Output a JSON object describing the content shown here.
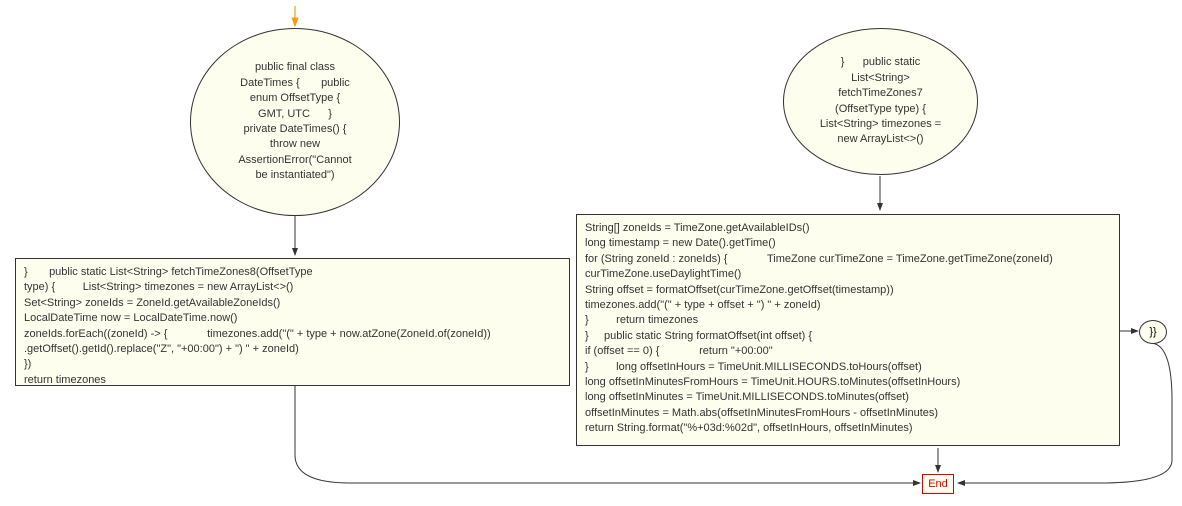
{
  "nodes": {
    "ellipse1": "public final class\nDateTimes {       public\nenum OffsetType {\nGMT, UTC      }\nprivate DateTimes() {\nthrow new\nAssertionError(\"Cannot\nbe instantiated\")",
    "rect1": "}       public static List<String> fetchTimeZones8(OffsetType\ntype) {         List<String> timezones = new ArrayList<>()\nSet<String> zoneIds = ZoneId.getAvailableZoneIds()\nLocalDateTime now = LocalDateTime.now()\nzoneIds.forEach((zoneId) -> {             timezones.add(\"(\" + type + now.atZone(ZoneId.of(zoneId))\n.getOffset().getId().replace(\"Z\", \"+00:00\") + \") \" + zoneId)\n})\nreturn timezones",
    "ellipse2": "}      public static\nList<String>\nfetchTimeZones7\n(OffsetType type) {\nList<String> timezones =\nnew ArrayList<>()",
    "rect2": "String[] zoneIds = TimeZone.getAvailableIDs()\nlong timestamp = new Date().getTime()\nfor (String zoneId : zoneIds) {             TimeZone curTimeZone = TimeZone.getTimeZone(zoneId)\ncurTimeZone.useDaylightTime()\nString offset = formatOffset(curTimeZone.getOffset(timestamp))\ntimezones.add(\"(\" + type + offset + \") \" + zoneId)\n}         return timezones\n}     public static String formatOffset(int offset) {\nif (offset == 0) {             return \"+00:00\"\n}         long offsetInHours = TimeUnit.MILLISECONDS.toHours(offset)\nlong offsetInMinutesFromHours = TimeUnit.HOURS.toMinutes(offsetInHours)\nlong offsetInMinutes = TimeUnit.MILLISECONDS.toMinutes(offset)\noffsetInMinutes = Math.abs(offsetInMinutesFromHours - offsetInMinutes)\nreturn String.format(\"%+03d:%02d\", offsetInHours, offsetInMinutes)",
    "end": "End",
    "small": "}}"
  }
}
